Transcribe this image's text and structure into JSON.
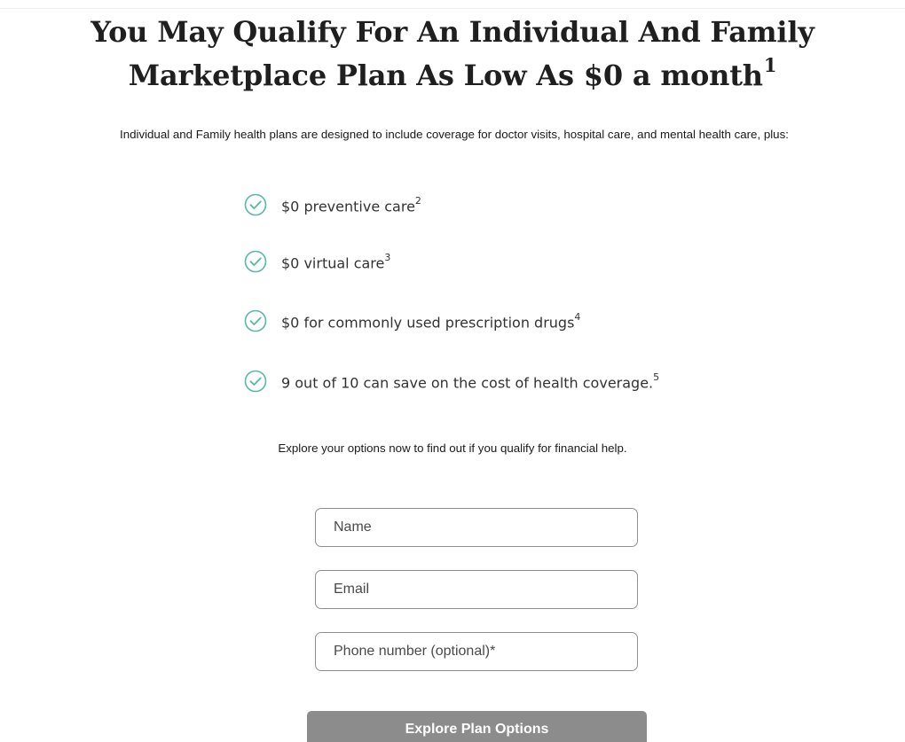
{
  "hero": {
    "title_line1": "You May Qualify For An Individual And Family",
    "title_line2": "Marketplace Plan As Low As $0 a month",
    "title_footnote": "1"
  },
  "intro": {
    "text": "Individual and Family health plans are designed to include coverage for doctor visits, hospital care, and mental health care, plus:"
  },
  "benefits": [
    {
      "text": "$0 preventive care",
      "footnote": "2",
      "icon": "check-circle-icon"
    },
    {
      "text": "$0 virtual care",
      "footnote": "3",
      "icon": "check-circle-icon"
    },
    {
      "text": "$0 for commonly used prescription drugs",
      "footnote": "4",
      "icon": "check-circle-icon"
    },
    {
      "text": "9 out of 10 can save on the cost of health coverage.",
      "footnote": "5",
      "icon": "check-circle-icon"
    }
  ],
  "form": {
    "prompt": "Explore your options now to find out if you qualify for financial help.",
    "name_placeholder": "Name",
    "email_placeholder": "Email",
    "phone_placeholder": "Phone number (optional)*",
    "submit_label": "Explore Plan Options"
  },
  "colors": {
    "check_icon": "#5ab7a8",
    "button_bg": "#8c8c8c"
  }
}
